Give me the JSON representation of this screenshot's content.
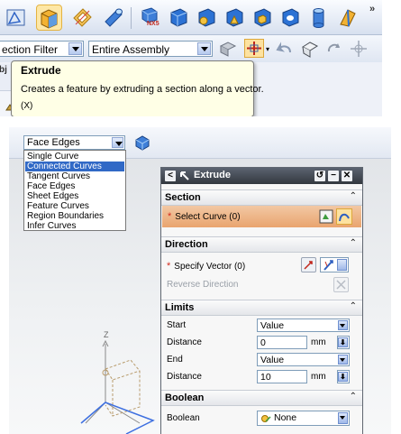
{
  "top": {
    "toolbar_icons": [
      "sketch-icon",
      "extrude-icon",
      "revolve-icon",
      "tube-icon",
      "nx5-block-icon",
      "block-icon",
      "cylinder-box-icon",
      "cone-box-icon",
      "sphere-box-icon",
      "hole-icon",
      "cylinder-icon",
      "taper-icon"
    ],
    "nx5_label": "NX5",
    "overflow_label": "»",
    "selection_filter": "ection Filter",
    "scope": "Entire Assembly",
    "left_stub_label": "bj",
    "tooltip": {
      "title": "Extrude",
      "description": "Creates a feature by extruding a section along a vector.",
      "shortcut": "(X)"
    }
  },
  "bottom": {
    "curve_rule": "Face Edges",
    "curve_rule_options": [
      "Single Curve",
      "Connected Curves",
      "Tangent Curves",
      "Face Edges",
      "Sheet Edges",
      "Feature Curves",
      "Region Boundaries",
      "Infer Curves"
    ],
    "highlighted_option": "Connected Curves",
    "triad_label": "Z",
    "dialog": {
      "title": "Extrude",
      "title_buttons": {
        "reset": "↺",
        "collapse": "−",
        "close": "✕"
      },
      "section": {
        "header": "Section",
        "select_curve": "Select Curve (0)"
      },
      "direction": {
        "header": "Direction",
        "specify_vector": "Specify Vector (0)",
        "reverse_direction": "Reverse Direction"
      },
      "limits": {
        "header": "Limits",
        "start_label": "Start",
        "start_value": "Value",
        "start_distance_label": "Distance",
        "start_distance": "0",
        "start_unit": "mm",
        "end_label": "End",
        "end_value": "Value",
        "end_distance_label": "Distance",
        "end_distance": "10",
        "end_unit": "mm"
      },
      "boolean": {
        "header": "Boolean",
        "label": "Boolean",
        "value": "None"
      }
    }
  },
  "colors": {
    "accent": "#3169c6",
    "section_highlight": "#e9a46e",
    "title_bar": "#3b414a"
  }
}
